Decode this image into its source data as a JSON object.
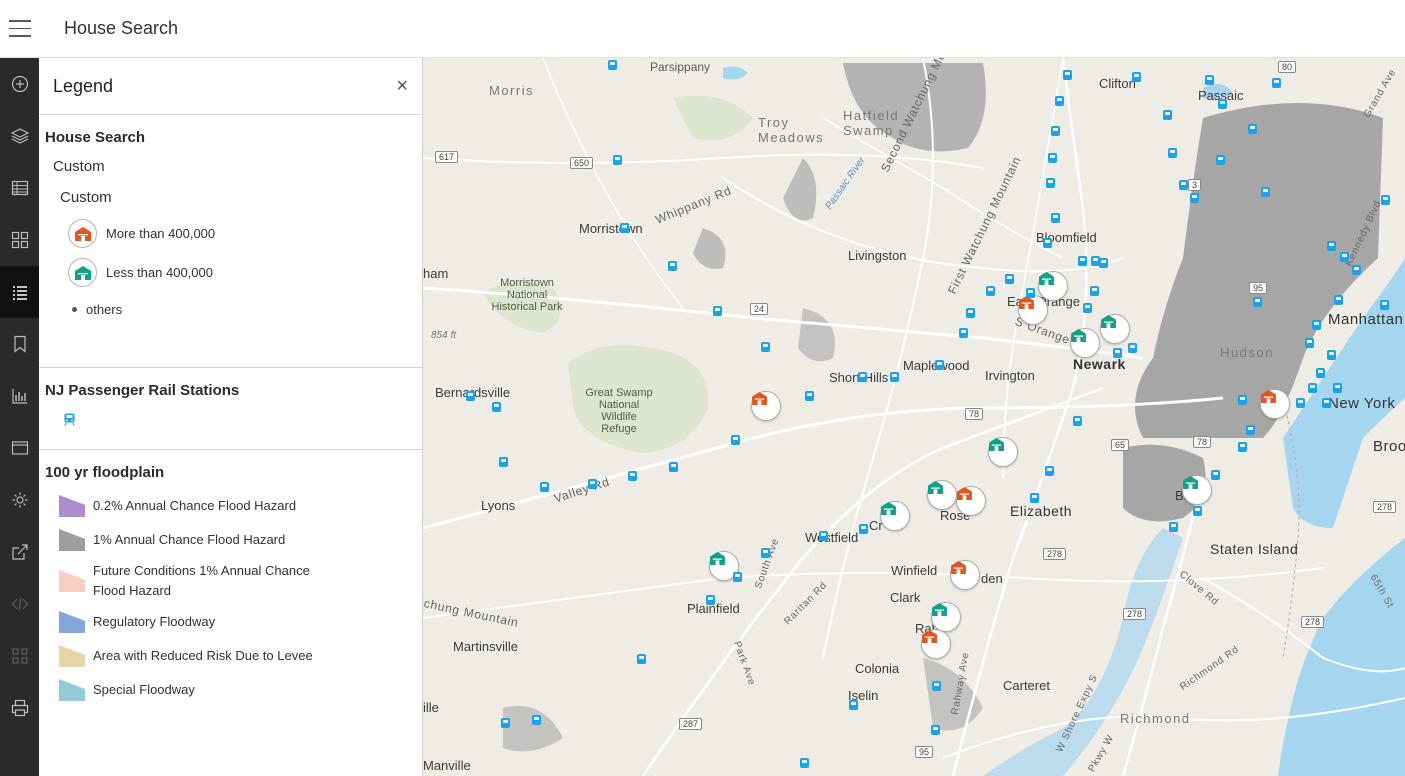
{
  "app": {
    "title": "House Search"
  },
  "legend": {
    "title": "Legend",
    "close_glyph": "×",
    "house_layer": {
      "title": "House Search",
      "sub1": "Custom",
      "sub2": "Custom",
      "more_label": "More than 400,000",
      "less_label": "Less than 400,000",
      "others_label": "others",
      "more_color": "#e1571c",
      "less_color": "#139f85"
    },
    "rail_layer": {
      "title": "NJ Passenger Rail Stations",
      "color": "#1aa3e8"
    },
    "flood_layer": {
      "title": "100 yr floodplain",
      "items": [
        {
          "label": "0.2% Annual Chance Flood Hazard",
          "color": "#ad8fcf"
        },
        {
          "label": "1% Annual Chance Flood Hazard",
          "color": "#9e9e9e"
        },
        {
          "label": "Future Conditions 1% Annual Chance Flood Hazard",
          "color": "#f6cfc0"
        },
        {
          "label": "Regulatory Floodway",
          "color": "#85a6d9"
        },
        {
          "label": "Area with Reduced Risk Due to Levee",
          "color": "#e6d6a9"
        },
        {
          "label": "Special Floodway",
          "color": "#93cbd6"
        }
      ]
    }
  },
  "map": {
    "labels": {
      "parsippany": "Parsippany",
      "morris": "Morris",
      "troy_meadows": "Troy Meadows",
      "hatfield_swamp": "Hatfield Swamp",
      "clifton": "Clifton",
      "passaic": "Passaic",
      "morristown": "Morristown",
      "whippany_rd": "Whippany Rd",
      "second_watchung": "Second Watchung Mountain",
      "first_watchung": "First Watchung Mountain",
      "livingston": "Livingston",
      "bloomfield": "Bloomfield",
      "ham": "ham",
      "morristown_nhp": "Morristown National Historical Park",
      "east_orange": "East Orange",
      "manhattan": "Manhattan",
      "s_orange_ave": "S Orange Ave",
      "newark": "Newark",
      "ft854": "854 ft",
      "maplewood": "Maplewood",
      "irvington": "Irvington",
      "short_hills": "Short Hills",
      "bernardsville": "Bernardsville",
      "great_swamp": "Great Swamp National Wildlife Refuge",
      "new_york": "New York",
      "brook": "Brook",
      "lyons": "Lyons",
      "valley_rd": "Valley Rd",
      "elizabeth": "Elizabeth",
      "roselle": "Rose",
      "cranford": "Cr",
      "staten_island": "Staten Island",
      "bay": "Bay",
      "westfield": "Westfield",
      "south_ave": "South Ave",
      "winfield": "Winfield",
      "linden": "den",
      "plainfield": "Plainfield",
      "clark": "Clark",
      "rahway": "Rah",
      "raritan_rd": "Raritan Rd",
      "watchung": "chung Mountain",
      "martinsville": "Martinsville",
      "colonia": "Colonia",
      "carteret": "Carteret",
      "iselin": "Iselin",
      "richmond": "Richmond",
      "richmond_rd": "Richmond Rd",
      "clove_rd": "Clove Rd",
      "park_ave": "Park Ave",
      "rahway_ave": "Rahway Ave",
      "w_shore": "W Shore Expy S",
      "pkwy": "Pkwy W",
      "ille": "ille",
      "manville": "Manville",
      "grand_ave": "Grand Ave",
      "kennedy_blvd": "Kennedy Blvd",
      "st65": "65th St",
      "hudson": "Hudson",
      "passaic_river": "Passaic River"
    },
    "shields": {
      "r617": "617",
      "r650": "650",
      "r24": "24",
      "r78": "78",
      "r80": "80",
      "r3": "3",
      "r95a": "95",
      "r95b": "95",
      "r278a": "278",
      "r278b": "278",
      "r278c": "278",
      "r278d": "278",
      "r287": "287",
      "r65": "65",
      "r78b": "78"
    }
  }
}
